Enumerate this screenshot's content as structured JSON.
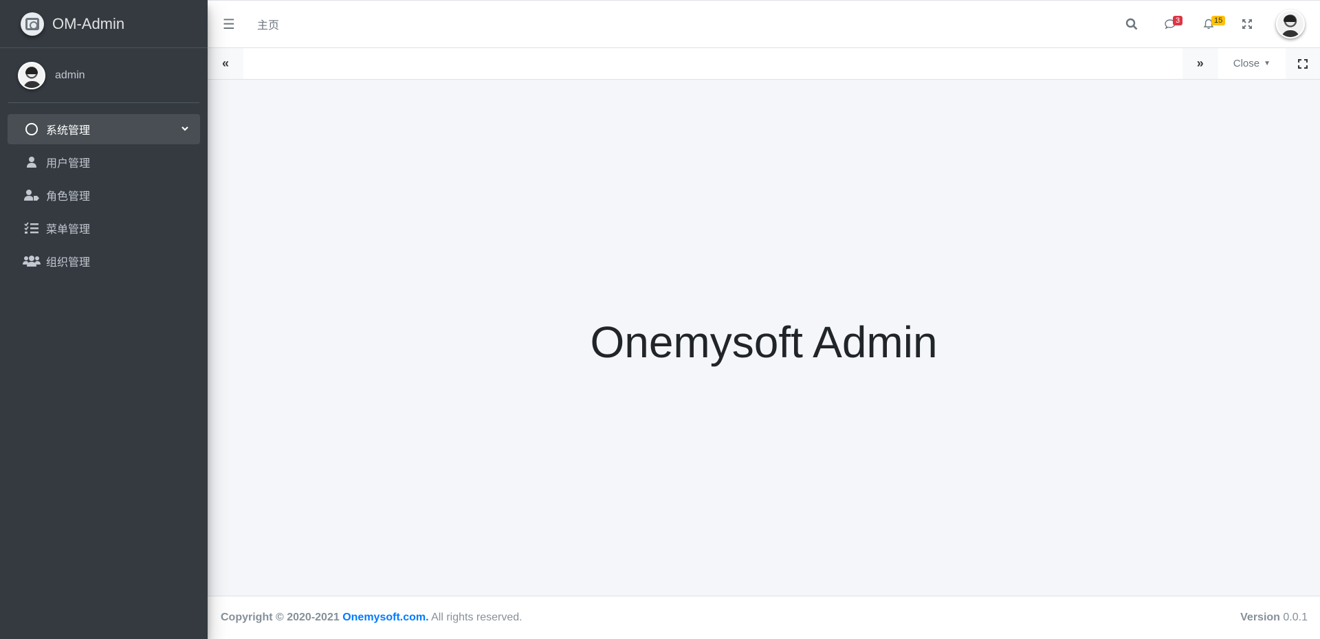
{
  "brand": {
    "name": "OM-Admin"
  },
  "user": {
    "name": "admin"
  },
  "sidebar": {
    "items": [
      {
        "label": "系统管理",
        "icon": "circle-icon",
        "active": true
      },
      {
        "label": "用户管理",
        "icon": "user-icon"
      },
      {
        "label": "角色管理",
        "icon": "user-tag-icon"
      },
      {
        "label": "菜单管理",
        "icon": "tasks-icon"
      },
      {
        "label": "组织管理",
        "icon": "users-icon"
      }
    ]
  },
  "navbar": {
    "home": "主页",
    "messages_count": "3",
    "notifications_count": "15"
  },
  "tabs": {
    "close_label": "Close"
  },
  "main": {
    "title": "Onemysoft Admin"
  },
  "footer": {
    "copyright": "Copyright © 2020-2021",
    "site": "Onemysoft.com.",
    "rights": "All rights reserved.",
    "version_label": "Version",
    "version": "0.0.1"
  },
  "colors": {
    "sidebar_bg": "#343a40",
    "content_bg": "#f4f6f9",
    "link": "#007bff",
    "badge_red": "#dc3545",
    "badge_yellow": "#ffc107"
  }
}
